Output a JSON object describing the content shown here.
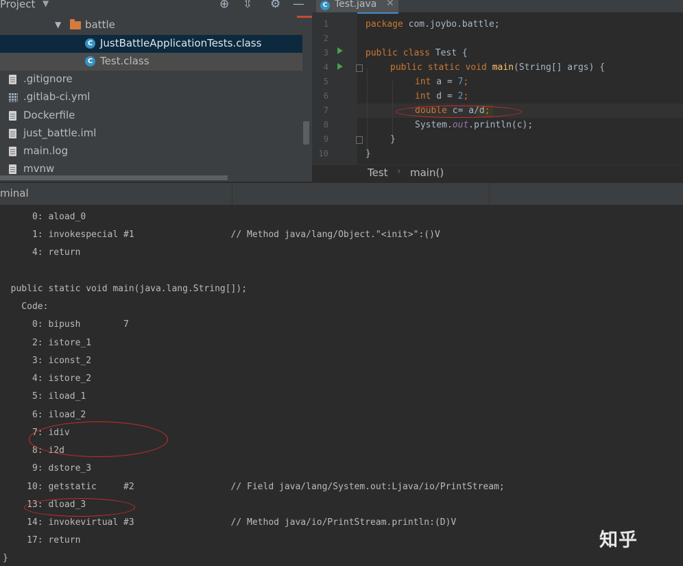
{
  "project_panel": {
    "title": "Project",
    "caret": "▼",
    "header_icons": {
      "target": "⊕",
      "collapse": "⇳",
      "settings": "⚙",
      "minimize": "—"
    },
    "tree": [
      {
        "label": "battle",
        "type": "folder",
        "expanded": true
      },
      {
        "label": "JustBattleApplicationTests.class",
        "type": "class",
        "selected": true
      },
      {
        "label": "Test.class",
        "type": "class",
        "hover": true
      },
      {
        "label": ".gitignore",
        "type": "text"
      },
      {
        "label": ".gitlab-ci.yml",
        "type": "yaml"
      },
      {
        "label": "Dockerfile",
        "type": "text"
      },
      {
        "label": "just_battle.iml",
        "type": "text"
      },
      {
        "label": "main.log",
        "type": "text"
      },
      {
        "label": "mvnw",
        "type": "text"
      }
    ]
  },
  "editor": {
    "tab": {
      "label": "Test.java",
      "close": "✕",
      "icon": "C"
    },
    "line_numbers": [
      "1",
      "2",
      "3",
      "4",
      "5",
      "6",
      "7",
      "8",
      "9",
      "10"
    ],
    "code": {
      "l1_kw": "package",
      "l1_rest": " com.joybo.battle;",
      "l3_kw": "public class",
      "l3_rest": " Test {",
      "l4_kw": "public static void",
      "l4_fn": "main",
      "l4_rest": "(String[] args) {",
      "l5_kw": "int",
      "l5_rest": " a = ",
      "l5_num": "7",
      "l5_end": ";",
      "l6_kw": "int",
      "l6_rest": " d = ",
      "l6_num": "2",
      "l6_end": ";",
      "l7_kw": "double",
      "l7_rest": " c= ",
      "l7_sel": "a/d",
      "l7_end": ";",
      "l8_a": "System.",
      "l8_fld": "out",
      "l8_b": ".println(c);",
      "l9": "}",
      "l10": "}"
    },
    "breadcrumb": {
      "class": "Test",
      "separator": "›",
      "method": "main()"
    }
  },
  "terminal": {
    "title": "minal",
    "lines": [
      "      0: aload_0",
      "      1: invokespecial #1                  // Method java/lang/Object.\"<init>\":()V",
      "      4: return",
      "",
      "  public static void main(java.lang.String[]);",
      "    Code:",
      "      0: bipush        7",
      "      2: istore_1",
      "      3: iconst_2",
      "      4: istore_2",
      "      5: iload_1",
      "      6: iload_2",
      "      7: idiv",
      "      8: i2d",
      "      9: dstore_3",
      "     10: getstatic     #2                  // Field java/lang/System.out:Ljava/io/PrintStream;",
      "     13: dload_3",
      "     14: invokevirtual #3                  // Method java/io/PrintStream.println:(D)V",
      "     17: return",
      "}"
    ]
  },
  "watermark": {
    "text": "知乎"
  },
  "colors": {
    "panel_bg": "#3c3f41",
    "editor_bg": "#2b2b2b",
    "selection_bg": "#0d293e",
    "keyword": "#cc7832",
    "number": "#6897bb",
    "function": "#ffc66d",
    "annotation_red": "#d12b2b"
  }
}
